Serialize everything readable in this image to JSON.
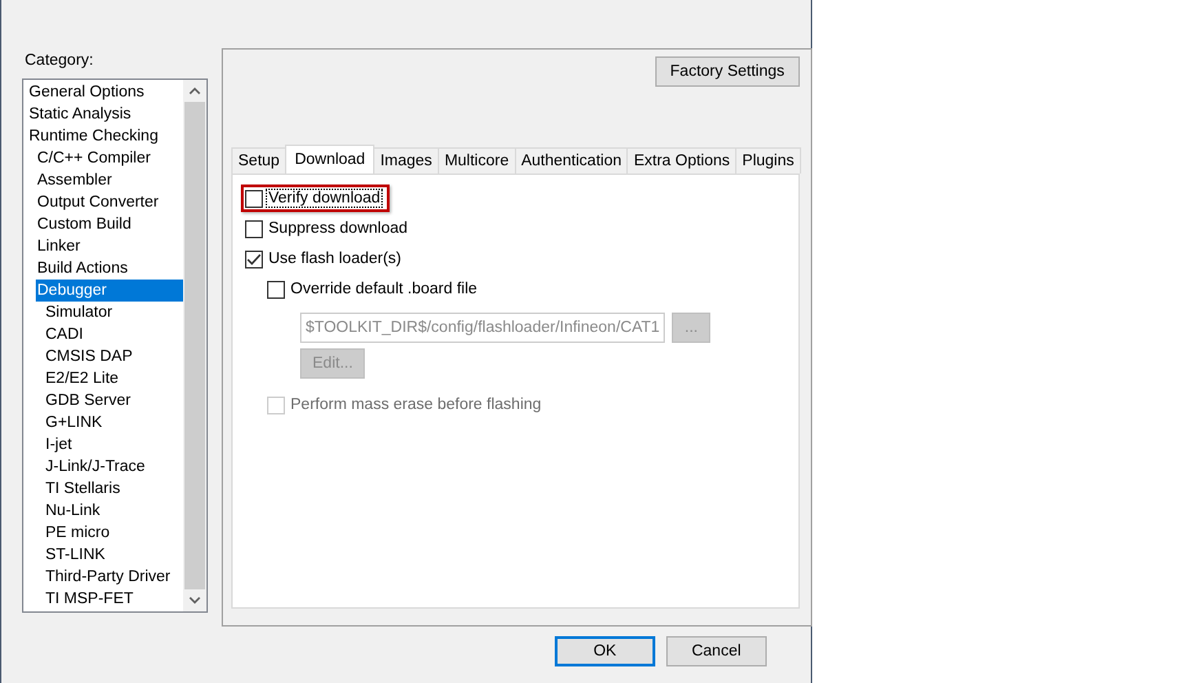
{
  "category": {
    "label": "Category:",
    "items": [
      {
        "label": "General Options",
        "selected": false
      },
      {
        "label": "Static Analysis",
        "selected": false
      },
      {
        "label": "Runtime Checking",
        "selected": false,
        "children": [
          {
            "label": "C/C++ Compiler",
            "selected": false
          },
          {
            "label": "Assembler",
            "selected": false
          },
          {
            "label": "Output Converter",
            "selected": false
          },
          {
            "label": "Custom Build",
            "selected": false
          },
          {
            "label": "Linker",
            "selected": false
          },
          {
            "label": "Build Actions",
            "selected": false
          },
          {
            "label": "Debugger",
            "selected": true,
            "children": [
              {
                "label": "Simulator",
                "selected": false
              },
              {
                "label": "CADI",
                "selected": false
              },
              {
                "label": "CMSIS DAP",
                "selected": false
              },
              {
                "label": "E2/E2 Lite",
                "selected": false
              },
              {
                "label": "GDB Server",
                "selected": false
              },
              {
                "label": "G+LINK",
                "selected": false
              },
              {
                "label": "I-jet",
                "selected": false
              },
              {
                "label": "J-Link/J-Trace",
                "selected": false
              },
              {
                "label": "TI Stellaris",
                "selected": false
              },
              {
                "label": "Nu-Link",
                "selected": false
              },
              {
                "label": "PE micro",
                "selected": false
              },
              {
                "label": "ST-LINK",
                "selected": false
              },
              {
                "label": "Third-Party Driver",
                "selected": false
              },
              {
                "label": "TI MSP-FET",
                "selected": false
              }
            ]
          }
        ]
      }
    ]
  },
  "factory_settings_button": "Factory Settings",
  "tabs": [
    {
      "label": "Setup",
      "selected": false
    },
    {
      "label": "Download",
      "selected": true
    },
    {
      "label": "Images",
      "selected": false
    },
    {
      "label": "Multicore",
      "selected": false
    },
    {
      "label": "Authentication",
      "selected": false
    },
    {
      "label": "Extra Options",
      "selected": false
    },
    {
      "label": "Plugins",
      "selected": false
    }
  ],
  "options": [
    {
      "kind": "checkbox",
      "label": "Verify download",
      "checked": false,
      "disabled": false,
      "highlighted": true,
      "focused": true,
      "indented": false
    },
    {
      "kind": "checkbox",
      "label": "Suppress download",
      "checked": false,
      "disabled": false,
      "highlighted": false,
      "focused": false,
      "indented": false
    },
    {
      "kind": "checkbox",
      "label": "Use flash loader(s)",
      "checked": true,
      "disabled": false,
      "highlighted": false,
      "focused": false,
      "indented": false
    },
    {
      "kind": "checkbox",
      "label": "Override default .board file",
      "checked": false,
      "disabled": false,
      "highlighted": false,
      "focused": false,
      "indented": true
    },
    {
      "kind": "path",
      "value": "$TOOLKIT_DIR$/config/flashloader/Infineon/CAT1",
      "browse": "...",
      "disabled": true
    },
    {
      "kind": "button",
      "label": "Edit...",
      "disabled": true
    },
    {
      "kind": "checkbox",
      "label": "Perform mass erase before flashing",
      "checked": false,
      "disabled": true,
      "highlighted": false,
      "focused": false,
      "indented": true
    }
  ],
  "buttons": [
    {
      "label": "OK",
      "default": true
    },
    {
      "label": "Cancel",
      "default": false
    }
  ]
}
